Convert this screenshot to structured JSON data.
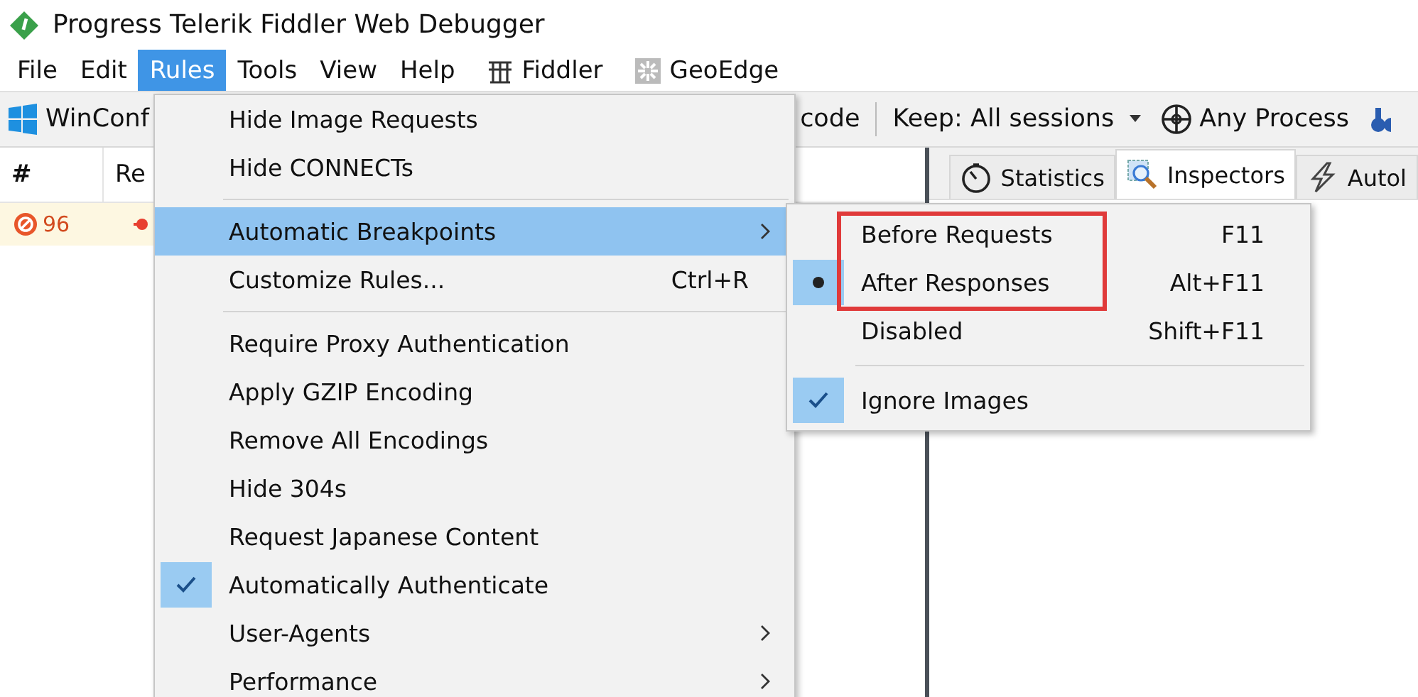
{
  "window": {
    "title": "Progress Telerik Fiddler Web Debugger"
  },
  "menubar": [
    {
      "label": "File",
      "selected": false
    },
    {
      "label": "Edit",
      "selected": false
    },
    {
      "label": "Rules",
      "selected": true
    },
    {
      "label": "Tools",
      "selected": false
    },
    {
      "label": "View",
      "selected": false
    },
    {
      "label": "Help",
      "selected": false
    },
    {
      "label": "Fiddler",
      "selected": false
    },
    {
      "label": "GeoEdge",
      "selected": false
    }
  ],
  "toolbar": {
    "winconfig": "WinConf",
    "decode": "code",
    "keep": "Keep: All sessions",
    "process": "Any Process"
  },
  "sessions": {
    "columns": [
      "#",
      "Re"
    ],
    "rows": [
      {
        "number": "96"
      }
    ]
  },
  "tabs": [
    {
      "label": "Statistics",
      "selected": false
    },
    {
      "label": "Inspectors",
      "selected": true
    },
    {
      "label": "Autol",
      "selected": false
    }
  ],
  "rules_menu": [
    {
      "kind": "item",
      "label": "Hide Image Requests",
      "checked": false,
      "selected": false,
      "submenu": false
    },
    {
      "kind": "item",
      "label": "Hide CONNECTs",
      "checked": false,
      "selected": false,
      "submenu": false
    },
    {
      "kind": "separator"
    },
    {
      "kind": "item",
      "label": "Automatic Breakpoints",
      "checked": false,
      "selected": true,
      "submenu": true
    },
    {
      "kind": "item",
      "label": "Customize Rules...",
      "shortcut": "Ctrl+R",
      "checked": false,
      "selected": false,
      "submenu": false
    },
    {
      "kind": "separator"
    },
    {
      "kind": "item",
      "label": "Require Proxy Authentication",
      "checked": false,
      "selected": false,
      "submenu": false
    },
    {
      "kind": "item",
      "label": "Apply GZIP Encoding",
      "checked": false,
      "selected": false,
      "submenu": false
    },
    {
      "kind": "item",
      "label": "Remove All Encodings",
      "checked": false,
      "selected": false,
      "submenu": false
    },
    {
      "kind": "item",
      "label": "Hide 304s",
      "checked": false,
      "selected": false,
      "submenu": false
    },
    {
      "kind": "item",
      "label": "Request Japanese Content",
      "checked": false,
      "selected": false,
      "submenu": false
    },
    {
      "kind": "item",
      "label": "Automatically Authenticate",
      "checked": true,
      "selected": false,
      "submenu": false
    },
    {
      "kind": "item",
      "label": "User-Agents",
      "checked": false,
      "selected": false,
      "submenu": true
    },
    {
      "kind": "item",
      "label": "Performance",
      "checked": false,
      "selected": false,
      "submenu": true
    }
  ],
  "breakpoints_menu": [
    {
      "kind": "radio",
      "label": "Before Requests",
      "shortcut": "F11",
      "checked": false,
      "outlined": true
    },
    {
      "kind": "radio",
      "label": "After Responses",
      "shortcut": "Alt+F11",
      "checked": true,
      "outlined": true
    },
    {
      "kind": "radio",
      "label": "Disabled",
      "shortcut": "Shift+F11",
      "checked": false,
      "outlined": false
    },
    {
      "kind": "separator"
    },
    {
      "kind": "check",
      "label": "Ignore Images",
      "checked": true,
      "outlined": false
    }
  ]
}
